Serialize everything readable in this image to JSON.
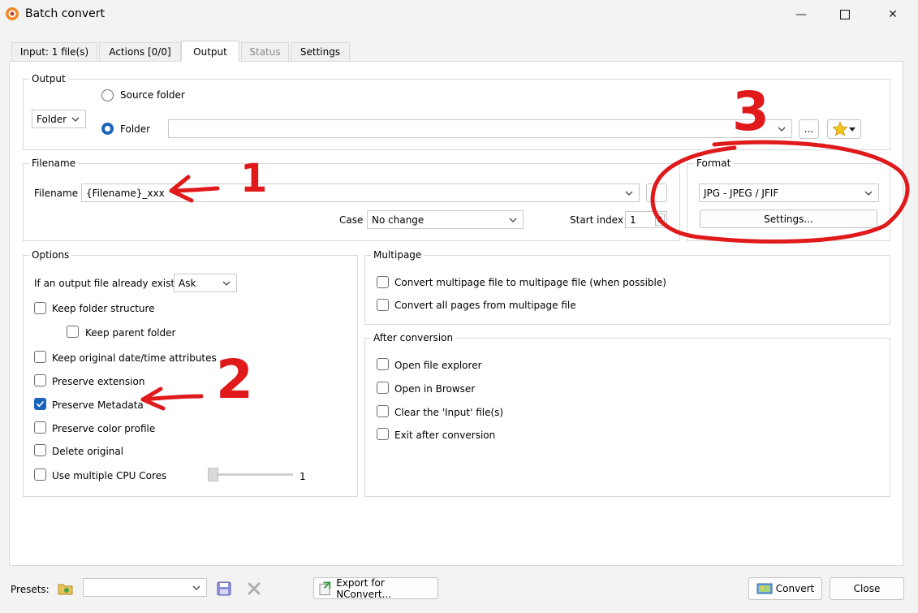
{
  "window": {
    "title": "Batch convert",
    "minimize_glyph": "—",
    "maximize_glyph": "☐",
    "close_glyph": "✕"
  },
  "tabs": [
    {
      "label": "Input: 1 file(s)"
    },
    {
      "label": "Actions [0/0]"
    },
    {
      "label": "Output"
    },
    {
      "label": "Status"
    },
    {
      "label": "Settings"
    }
  ],
  "output": {
    "group_label": "Output",
    "mode_value": "Folder",
    "source_folder_label": "Source folder",
    "folder_label": "Folder",
    "folder_value": "",
    "browse_label": "..."
  },
  "filename": {
    "group_label": "Filename",
    "field_label": "Filename",
    "value": "{Filename}_xxx",
    "case_label": "Case",
    "case_value": "No change",
    "start_index_label": "Start index",
    "start_index_value": "1"
  },
  "format": {
    "group_label": "Format",
    "value": "JPG - JPEG / JFIF",
    "settings_label": "Settings..."
  },
  "options": {
    "group_label": "Options",
    "exists_label": "If an output file already exists",
    "exists_value": "Ask",
    "keep_folder_structure": "Keep folder structure",
    "keep_parent_folder": "Keep parent folder",
    "keep_datetime": "Keep original date/time attributes",
    "preserve_extension": "Preserve extension",
    "preserve_metadata": "Preserve Metadata",
    "preserve_color_profile": "Preserve color profile",
    "delete_original": "Delete original",
    "multiple_cpu": "Use multiple CPU Cores",
    "cpu_value": "1"
  },
  "multipage": {
    "group_label": "Multipage",
    "convert_multipage": "Convert multipage file to multipage file (when possible)",
    "convert_all_pages": "Convert all pages from multipage file"
  },
  "after": {
    "group_label": "After conversion",
    "open_explorer": "Open file explorer",
    "open_browser": "Open in Browser",
    "clear_input": "Clear the 'Input' file(s)",
    "exit_after": "Exit after conversion"
  },
  "bottom": {
    "presets_label": "Presets:",
    "presets_value": "",
    "export_label": "Export for NConvert...",
    "convert_label": "Convert",
    "close_label": "Close"
  },
  "annotations": {
    "mark_1": "1",
    "mark_2": "2",
    "mark_3": "3",
    "ink_color": "#e0191b"
  },
  "colors": {
    "accent": "#1a63b8"
  }
}
